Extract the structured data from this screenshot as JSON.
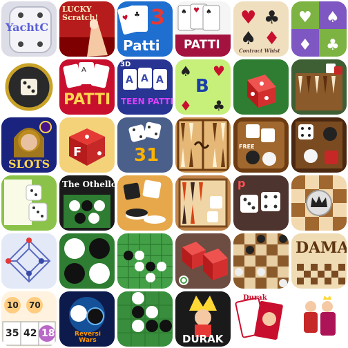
{
  "grid": {
    "rows": [
      [
        {
          "name": "yachtc-app-icon",
          "label": "YachtC"
        },
        {
          "name": "lucky-scratch-app-icon",
          "label": "LUCKY Scratch!"
        },
        {
          "name": "3-patti-app-icon",
          "label": "Patti",
          "num": "3"
        },
        {
          "name": "patti-cards-app-icon",
          "label": "PATTI"
        },
        {
          "name": "contract-whist-app-icon",
          "label": "Contract Whist"
        },
        {
          "name": "card-suits-app-icon",
          "label": ""
        }
      ],
      [
        {
          "name": "dice-laurel-app-icon",
          "label": ""
        },
        {
          "name": "patti-app-icon",
          "label": "PATTI"
        },
        {
          "name": "3d-teen-patti-app-icon",
          "label": "TEEN PATTI",
          "tag": "3D"
        },
        {
          "name": "bridge-b-app-icon",
          "label": "B"
        },
        {
          "name": "red-dice-app-icon",
          "label": ""
        },
        {
          "name": "backgammon-board-app-icon",
          "label": ""
        }
      ],
      [
        {
          "name": "slots-app-icon",
          "label": "SLOTS"
        },
        {
          "name": "dice-f-app-icon",
          "label": "F"
        },
        {
          "name": "dice-31-app-icon",
          "label": "31"
        },
        {
          "name": "backgammon-dragon-app-icon",
          "label": ""
        },
        {
          "name": "backgammon-free-app-icon",
          "label": "FREE"
        },
        {
          "name": "dice-checkers-app-icon",
          "label": ""
        }
      ],
      [
        {
          "name": "dice-notebook-app-icon",
          "label": ""
        },
        {
          "name": "othello-app-icon",
          "label": "The Othello"
        },
        {
          "name": "reversi-dice-app-icon",
          "label": ""
        },
        {
          "name": "backgammon-classic-app-icon",
          "label": ""
        },
        {
          "name": "backgammon-p-app-icon",
          "label": "p"
        },
        {
          "name": "checkers-crown-app-icon",
          "label": ""
        }
      ],
      [
        {
          "name": "nine-mens-morris-app-icon",
          "label": ""
        },
        {
          "name": "reversi-green-app-icon",
          "label": ""
        },
        {
          "name": "gomoku-app-icon",
          "label": ""
        },
        {
          "name": "dice-power-app-icon",
          "label": ""
        },
        {
          "name": "checkers-board-app-icon",
          "label": ""
        },
        {
          "name": "dama-app-icon",
          "label": "DAMA"
        }
      ],
      [
        {
          "name": "bingo-app-icon",
          "label": "",
          "nums": [
            "10",
            "70",
            "35",
            "42",
            "18"
          ]
        },
        {
          "name": "reversi-wars-app-icon",
          "label": "Reversi Wars"
        },
        {
          "name": "reversi-stones-app-icon",
          "label": ""
        },
        {
          "name": "durak-app-icon",
          "label": "DURAK"
        },
        {
          "name": "durak-cards-app-icon",
          "label": "Durak"
        },
        {
          "name": "ludo-king-app-icon",
          "label": ""
        }
      ]
    ]
  },
  "colors": {
    "page_bg": "#ffffff",
    "patti_red": "#c8102e",
    "blue": "#1f6fd1",
    "felt_green": "#2e7d32",
    "wood": "#8b5a2b",
    "suits_green": "#7cb342",
    "suits_purple": "#7e57c2"
  }
}
